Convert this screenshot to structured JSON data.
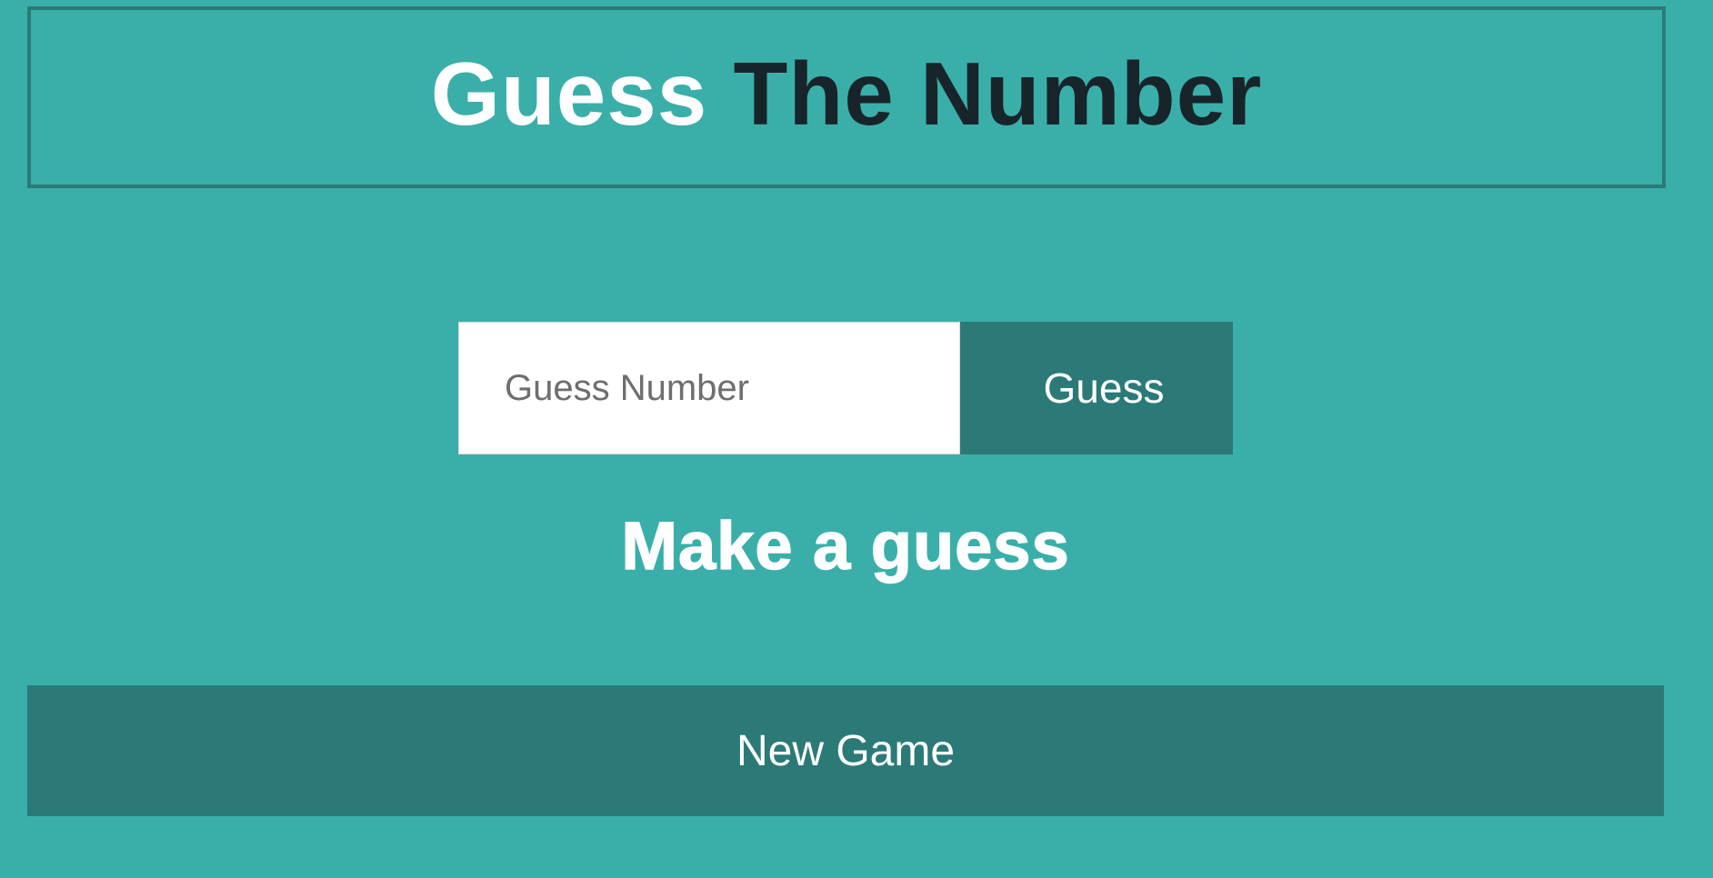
{
  "header": {
    "title_part1": "Guess",
    "title_part2": "The Number"
  },
  "guess_form": {
    "input_value": "",
    "input_placeholder": "Guess Number",
    "button_label": "Guess"
  },
  "status": {
    "message": "Make a guess"
  },
  "footer": {
    "new_game_label": "New Game"
  },
  "colors": {
    "background": "#3aafa9",
    "accent_dark": "#2b7a78",
    "title_dark": "#17252a",
    "text_light": "#ffffff"
  }
}
